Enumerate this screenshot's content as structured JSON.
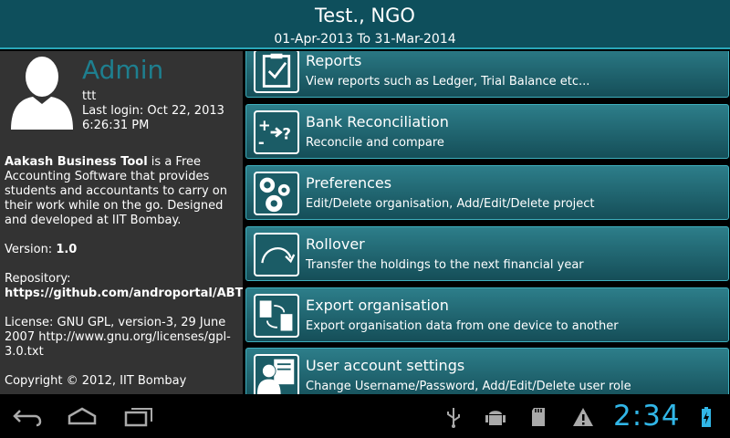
{
  "header": {
    "title": "Test., NGO",
    "subtitle": "01-Apr-2013 To 31-Mar-2014"
  },
  "sidebar": {
    "role": "Admin",
    "username": "ttt",
    "last_login": "Last login: Oct 22, 2013 6:26:31 PM",
    "about_app_name": "Aakash Business Tool",
    "about_text": " is a Free Accounting Software that provides students and accountants to carry on their work while on the go. Designed and developed at IIT Bombay.",
    "version_label": "Version: ",
    "version_value": "1.0",
    "repo_label": "Repository: ",
    "repo_value": "https://github.com/androportal/ABT",
    "license": "License: GNU GPL, version-3, 29 June 2007 http://www.gnu.org/licenses/gpl-3.0.txt",
    "copyright": "Copyright © 2012, IIT Bombay"
  },
  "menu": [
    {
      "title": "Reports",
      "desc": "View reports such as Ledger, Trial Balance etc...",
      "icon": "clipboard-check-icon"
    },
    {
      "title": "Bank Reconciliation",
      "desc": "Reconcile and compare",
      "icon": "bank-reconcile-icon"
    },
    {
      "title": "Preferences",
      "desc": "Edit/Delete organisation, Add/Edit/Delete project",
      "icon": "gears-icon"
    },
    {
      "title": "Rollover",
      "desc": "Transfer the holdings to the next financial year",
      "icon": "rollover-arrow-icon"
    },
    {
      "title": "Export organisation",
      "desc": "Export organisation data from one device to another",
      "icon": "export-devices-icon"
    },
    {
      "title": "User account settings",
      "desc": "Change Username/Password, Add/Edit/Delete user role",
      "icon": "user-settings-icon"
    }
  ],
  "statusbar": {
    "time": "2:34"
  },
  "colors": {
    "header_bg": "#0e4f5c",
    "accent": "#2aa7b8",
    "admin_text": "#1e7f8f",
    "clock": "#31b6e7"
  }
}
